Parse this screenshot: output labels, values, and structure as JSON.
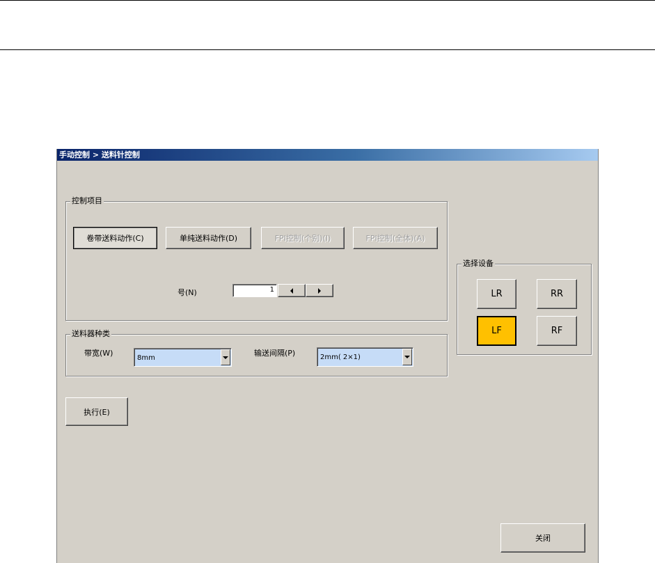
{
  "window": {
    "title": "手动控制 > 送料针控制"
  },
  "control_group": {
    "legend": "控制项目",
    "buttons": {
      "reel_feed": "卷带送料动作(C)",
      "simple_feed": "单纯送料动作(D)",
      "fpi_individual": "FPI控制(个别)(I)",
      "fpi_all": "FPI控制(全体)(A)"
    },
    "number": {
      "label": "号(N)",
      "value": "1"
    }
  },
  "feeder_group": {
    "legend": "送料器种类",
    "tape_width": {
      "label": "带宽(W)",
      "value": "8mm"
    },
    "feed_pitch": {
      "label": "输送间隔(P)",
      "value": "2mm( 2×1)"
    }
  },
  "device_group": {
    "legend": "选择设备",
    "buttons": {
      "lr": "LR",
      "rr": "RR",
      "lf": "LF",
      "rf": "RF"
    },
    "selected": "LF",
    "selected_color": "#ffc000"
  },
  "execute_label": "执行(E)",
  "close_label": "关闭"
}
